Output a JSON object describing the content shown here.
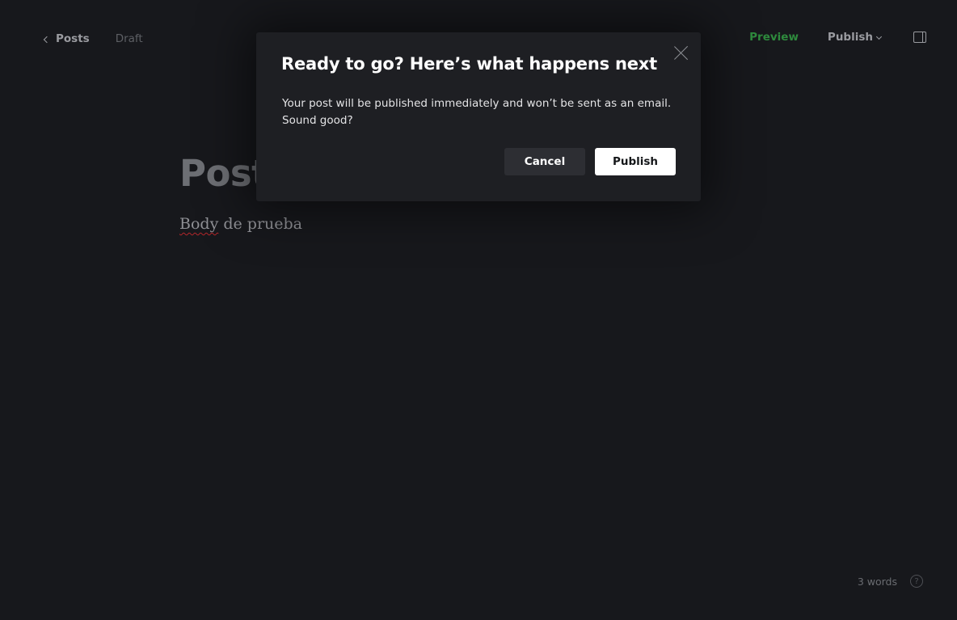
{
  "topbar": {
    "back_label": "Posts",
    "status": "Draft",
    "preview_label": "Preview",
    "publish_label": "Publish"
  },
  "editor": {
    "title": "Post",
    "body_word1": "Body",
    "body_rest": " de prueba"
  },
  "footer": {
    "word_count": "3 words",
    "help_glyph": "?"
  },
  "modal": {
    "title": "Ready to go? Here’s what happens next",
    "message_line1": "Your post will be published immediately and won’t be sent as an email.",
    "message_line2": "Sound good?",
    "cancel_label": "Cancel",
    "publish_label": "Publish"
  },
  "icons": {
    "back": "chevron-left-icon",
    "dropdown": "chevron-down-icon",
    "sidebar": "sidebar-toggle-icon",
    "close": "close-icon",
    "help": "help-icon"
  },
  "colors": {
    "background": "#17181c",
    "modal_background": "#1e1f23",
    "accent_green": "#2e8a3d",
    "primary_button": "#ffffff",
    "secondary_button": "#2d2e33"
  }
}
